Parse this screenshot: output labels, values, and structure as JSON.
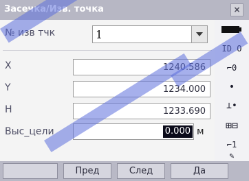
{
  "window": {
    "title": "Засечка/Изв. точка",
    "close_label": "×"
  },
  "form": {
    "point_label": "№ изв тчк",
    "point_value": "1",
    "x_label": "X",
    "x_value": "1240.586",
    "y_label": "Y",
    "y_value": "1234.000",
    "h_label": "H",
    "h_value": "1233.690",
    "target_label": "Выс_цели",
    "target_value": "0.000",
    "target_unit": "м"
  },
  "sidebar": {
    "items": [
      {
        "icon": "battery-icon",
        "glyph": "▬"
      },
      {
        "icon": "id-switch-icon",
        "glyph": "ID O"
      },
      {
        "icon": "prism-constant-icon",
        "glyph": "⌐0"
      },
      {
        "icon": "dot-icon",
        "glyph": "•"
      },
      {
        "icon": "level-icon",
        "glyph": "⊥•"
      },
      {
        "icon": "keyboard-icon",
        "glyph": "⊞"
      },
      {
        "icon": "target-height-icon",
        "glyph": "⌐1"
      },
      {
        "icon": "edit-icon",
        "glyph": "✎"
      }
    ]
  },
  "softkeys": [
    {
      "label": ""
    },
    {
      "label": "Пред"
    },
    {
      "label": "След"
    },
    {
      "label": "Да"
    }
  ],
  "colors": {
    "titlebar": "#b7b7c4",
    "softkey_bar": "#b9b9c6",
    "selection": "#0b0b1a",
    "watermark": "#5c70dc"
  }
}
